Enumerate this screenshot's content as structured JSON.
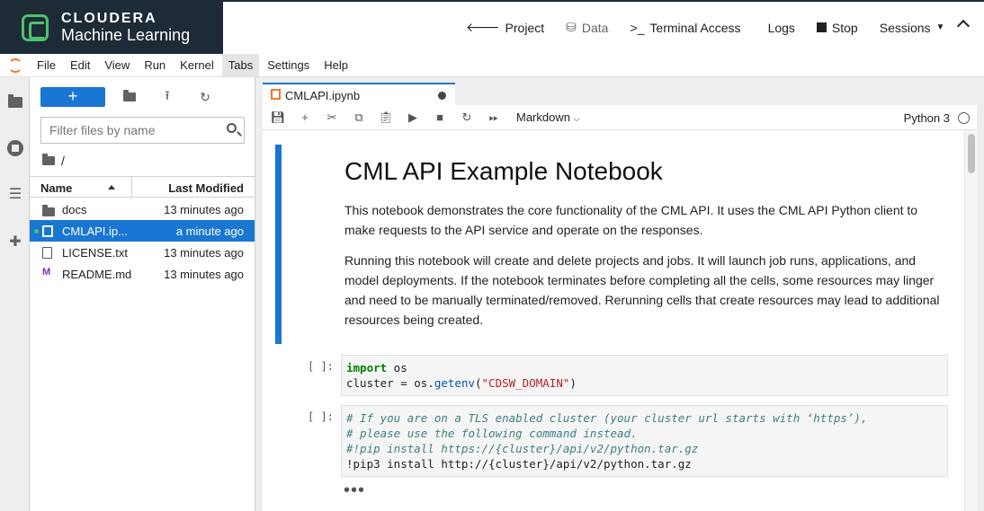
{
  "brand": {
    "name": "CLOUDERA",
    "product": "Machine Learning"
  },
  "topnav": {
    "project": "Project",
    "data": "Data",
    "terminal": "Terminal Access",
    "logs": "Logs",
    "stop": "Stop",
    "sessions": "Sessions"
  },
  "menu": [
    "File",
    "Edit",
    "View",
    "Run",
    "Kernel",
    "Tabs",
    "Settings",
    "Help"
  ],
  "filebrowser": {
    "filter_placeholder": "Filter files by name",
    "path": "/",
    "col_name": "Name",
    "col_modified": "Last Modified",
    "files": [
      {
        "name": "docs",
        "modified": "13 minutes ago",
        "type": "folder"
      },
      {
        "name": "CMLAPI.ip...",
        "modified": "a minute ago",
        "type": "notebook",
        "selected": true,
        "running": true
      },
      {
        "name": "LICENSE.txt",
        "modified": "13 minutes ago",
        "type": "text"
      },
      {
        "name": "README.md",
        "modified": "13 minutes ago",
        "type": "markdown"
      }
    ]
  },
  "tab": {
    "label": "CMLAPI.ipynb"
  },
  "toolbar": {
    "cell_type": "Markdown",
    "kernel": "Python 3"
  },
  "notebook": {
    "heading": "CML API Example Notebook",
    "para1": "This notebook demonstrates the core functionality of the CML API. It uses the CML API Python client to make requests to the API service and operate on the responses.",
    "para2": "Running this notebook will create and delete projects and jobs. It will launch job runs, applications, and model deployments. If the notebook terminates before completing all the cells, some resources may linger and need to be manually terminated/removed. Rerunning cells that create resources may lead to additional resources being created.",
    "prompt1": "[ ]:",
    "prompt2": "[ ]:",
    "code1_kw": "import",
    "code1_mod": " os",
    "code1_line2a": "cluster = os.",
    "code1_fn": "getenv",
    "code1_str": "\"CDSW_DOMAIN\"",
    "code2_c1": "# If you are on a TLS enabled cluster (your cluster url starts with ‘https’),",
    "code2_c2": "# please use the following command instead.",
    "code2_c3": "#!pip install https://{cluster}/api/v2/python.tar.gz",
    "code2_l4": "!pip3 install http://{cluster}/api/v2/python.tar.gz",
    "ellipsis": "•••"
  }
}
